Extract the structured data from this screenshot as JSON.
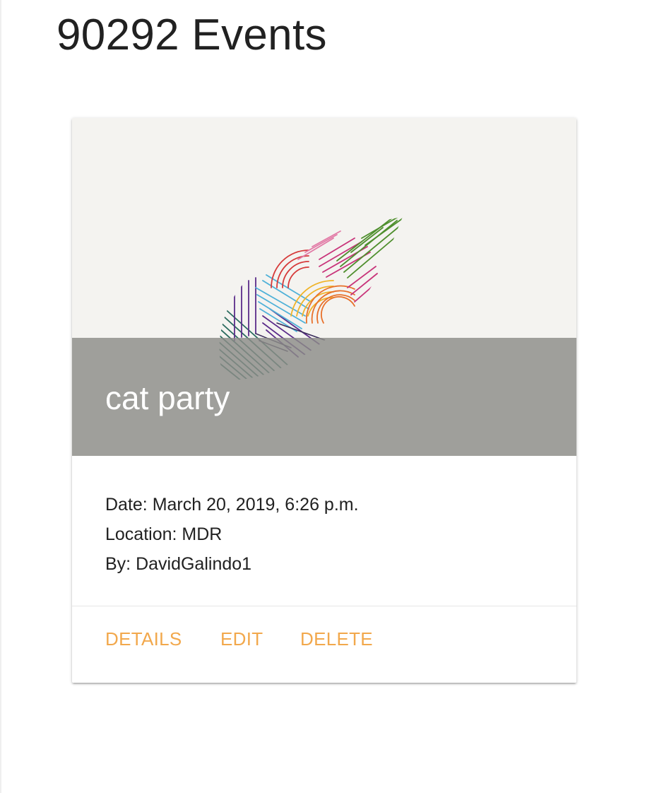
{
  "page": {
    "title": "90292 Events"
  },
  "event_card": {
    "title": "cat party",
    "date_line": "Date: March 20, 2019, 6:26 p.m.",
    "location_line": "Location: MDR",
    "by_line": "By: DavidGalindo1",
    "actions": {
      "details_label": "DETAILS",
      "edit_label": "EDIT",
      "delete_label": "DELETE"
    },
    "image_icon": "rainbow-leaf-icon"
  },
  "colors": {
    "accent": "#f2a84c",
    "card_image_background": "#f4f3f0",
    "title_band": "#9e9e99"
  }
}
